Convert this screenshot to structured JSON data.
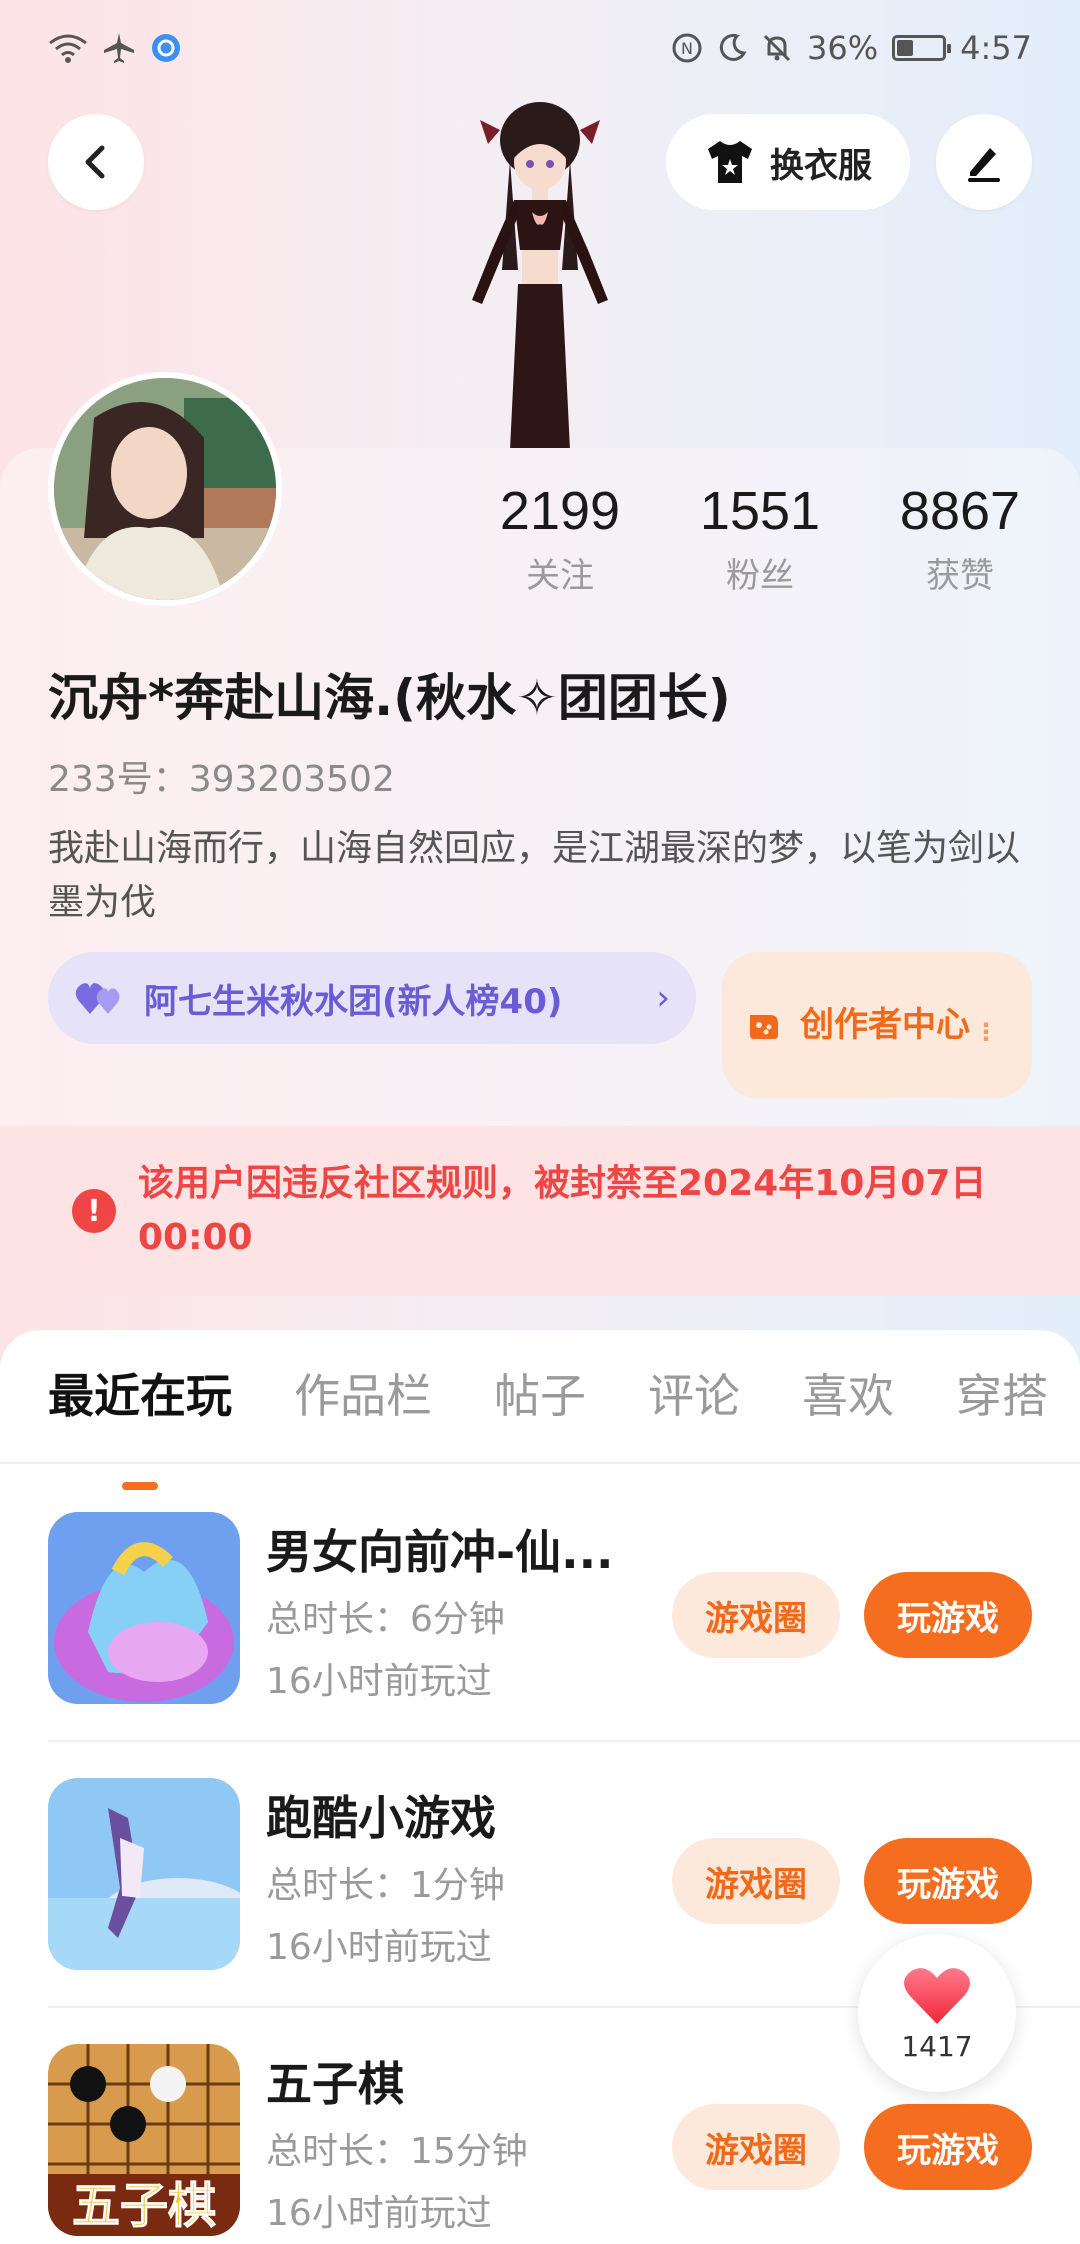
{
  "status_bar": {
    "battery": "36%",
    "battery_level": 0.36,
    "time": "4:57"
  },
  "header": {
    "dress_label": "换衣服"
  },
  "profile": {
    "stats": [
      {
        "value": "2199",
        "label": "关注"
      },
      {
        "value": "1551",
        "label": "粉丝"
      },
      {
        "value": "8867",
        "label": "获赞"
      }
    ],
    "nickname": "沉舟*奔赴山海.(秋水✧团团长)",
    "uid": "233号：393203502",
    "bio": "我赴山海而行，山海自然回应，是江湖最深的梦，以笔为剑以墨为伐",
    "group": {
      "label": "阿七生米秋水团(新人榜40)",
      "arrow": "›"
    },
    "creator": {
      "label": "创作者中心",
      "dots": "⋮"
    }
  },
  "ban_notice": "该用户因违反社区规则，被封禁至2024年10月07日 00:00",
  "tabs": [
    "最近在玩",
    "作品栏",
    "帖子",
    "评论",
    "喜欢",
    "穿搭"
  ],
  "games": [
    {
      "name": "男女向前冲-仙...",
      "duration": "总时长：6分钟",
      "last_played": "16小时前玩过",
      "circle_label": "游戏圈",
      "play_label": "玩游戏"
    },
    {
      "name": "跑酷小游戏",
      "duration": "总时长：1分钟",
      "last_played": "16小时前玩过",
      "circle_label": "游戏圈",
      "play_label": "玩游戏"
    },
    {
      "name": "五子棋",
      "duration": "总时长：15分钟",
      "last_played": "16小时前玩过",
      "circle_label": "游戏圈",
      "play_label": "玩游戏",
      "thumb_text": "五子棋"
    }
  ],
  "like_float": {
    "count": "1417"
  },
  "colors": {
    "accent": "#f56d1e",
    "ban_red": "#ee4545",
    "group_purple": "#6a5bd6"
  }
}
